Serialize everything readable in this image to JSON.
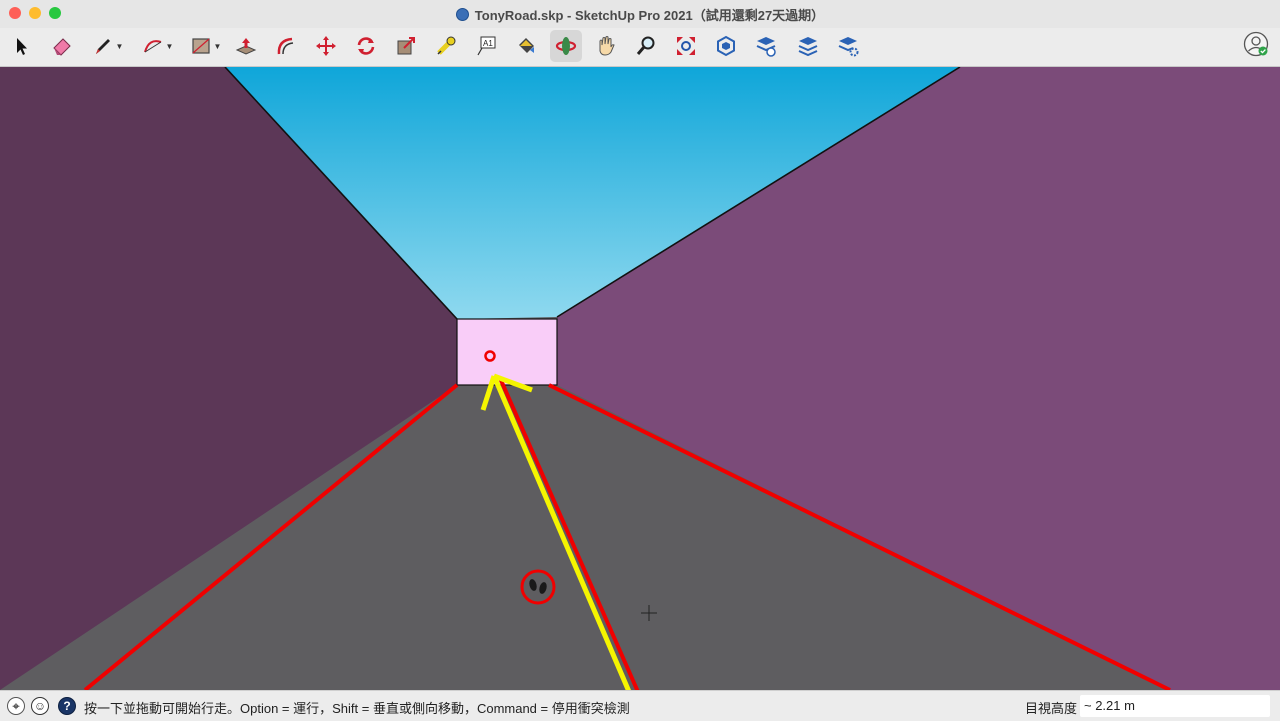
{
  "window": {
    "title": "TonyRoad.skp - SketchUp Pro 2021（試用還剩27天過期）"
  },
  "toolbar": {
    "tools": [
      {
        "name": "select-tool",
        "icon": "arrow-cursor-icon"
      },
      {
        "name": "eraser-tool",
        "icon": "eraser-icon"
      },
      {
        "name": "line-tool",
        "icon": "pencil-icon"
      },
      {
        "name": "arc-tool",
        "icon": "arc-icon"
      },
      {
        "name": "rectangle-tool",
        "icon": "rectangle-icon"
      },
      {
        "name": "push-pull-tool",
        "icon": "push-pull-icon"
      },
      {
        "name": "offset-tool",
        "icon": "offset-icon"
      },
      {
        "name": "move-tool",
        "icon": "move-arrows-icon"
      },
      {
        "name": "rotate-tool",
        "icon": "rotate-icon"
      },
      {
        "name": "scale-tool",
        "icon": "scale-icon"
      },
      {
        "name": "tape-measure-tool",
        "icon": "tape-measure-icon"
      },
      {
        "name": "text-tool",
        "icon": "text-icon"
      },
      {
        "name": "paint-bucket-tool",
        "icon": "paint-bucket-icon"
      },
      {
        "name": "orbit-tool",
        "icon": "orbit-icon"
      },
      {
        "name": "pan-tool",
        "icon": "hand-icon"
      },
      {
        "name": "zoom-tool",
        "icon": "magnifier-icon"
      },
      {
        "name": "zoom-extents-tool",
        "icon": "zoom-extents-icon"
      },
      {
        "name": "warehouse-tool",
        "icon": "3d-warehouse-icon"
      },
      {
        "name": "extension-warehouse-tool",
        "icon": "extension-warehouse-icon"
      },
      {
        "name": "layout-tool",
        "icon": "layout-send-icon"
      },
      {
        "name": "extension-manager-tool",
        "icon": "extension-manager-icon"
      }
    ],
    "account_icon": "user-account-icon"
  },
  "status": {
    "instruction": "按一下並拖動可開始行走。Option = 運行，Shift = 垂直或側向移動，Command = 停用衝突檢測",
    "measure_label": "目視高度",
    "measure_value": "~ 2.21 m"
  },
  "colors": {
    "left_wall": "#5c3757",
    "right_wall": "#7b4b79",
    "ground": "#5e5d60",
    "end_face": "#f9cdf8",
    "sky_top": "#0fa6d9",
    "sky_bottom": "#8fd9ef",
    "annotation_red": "#f00000",
    "annotation_yellow": "#f5f500"
  }
}
